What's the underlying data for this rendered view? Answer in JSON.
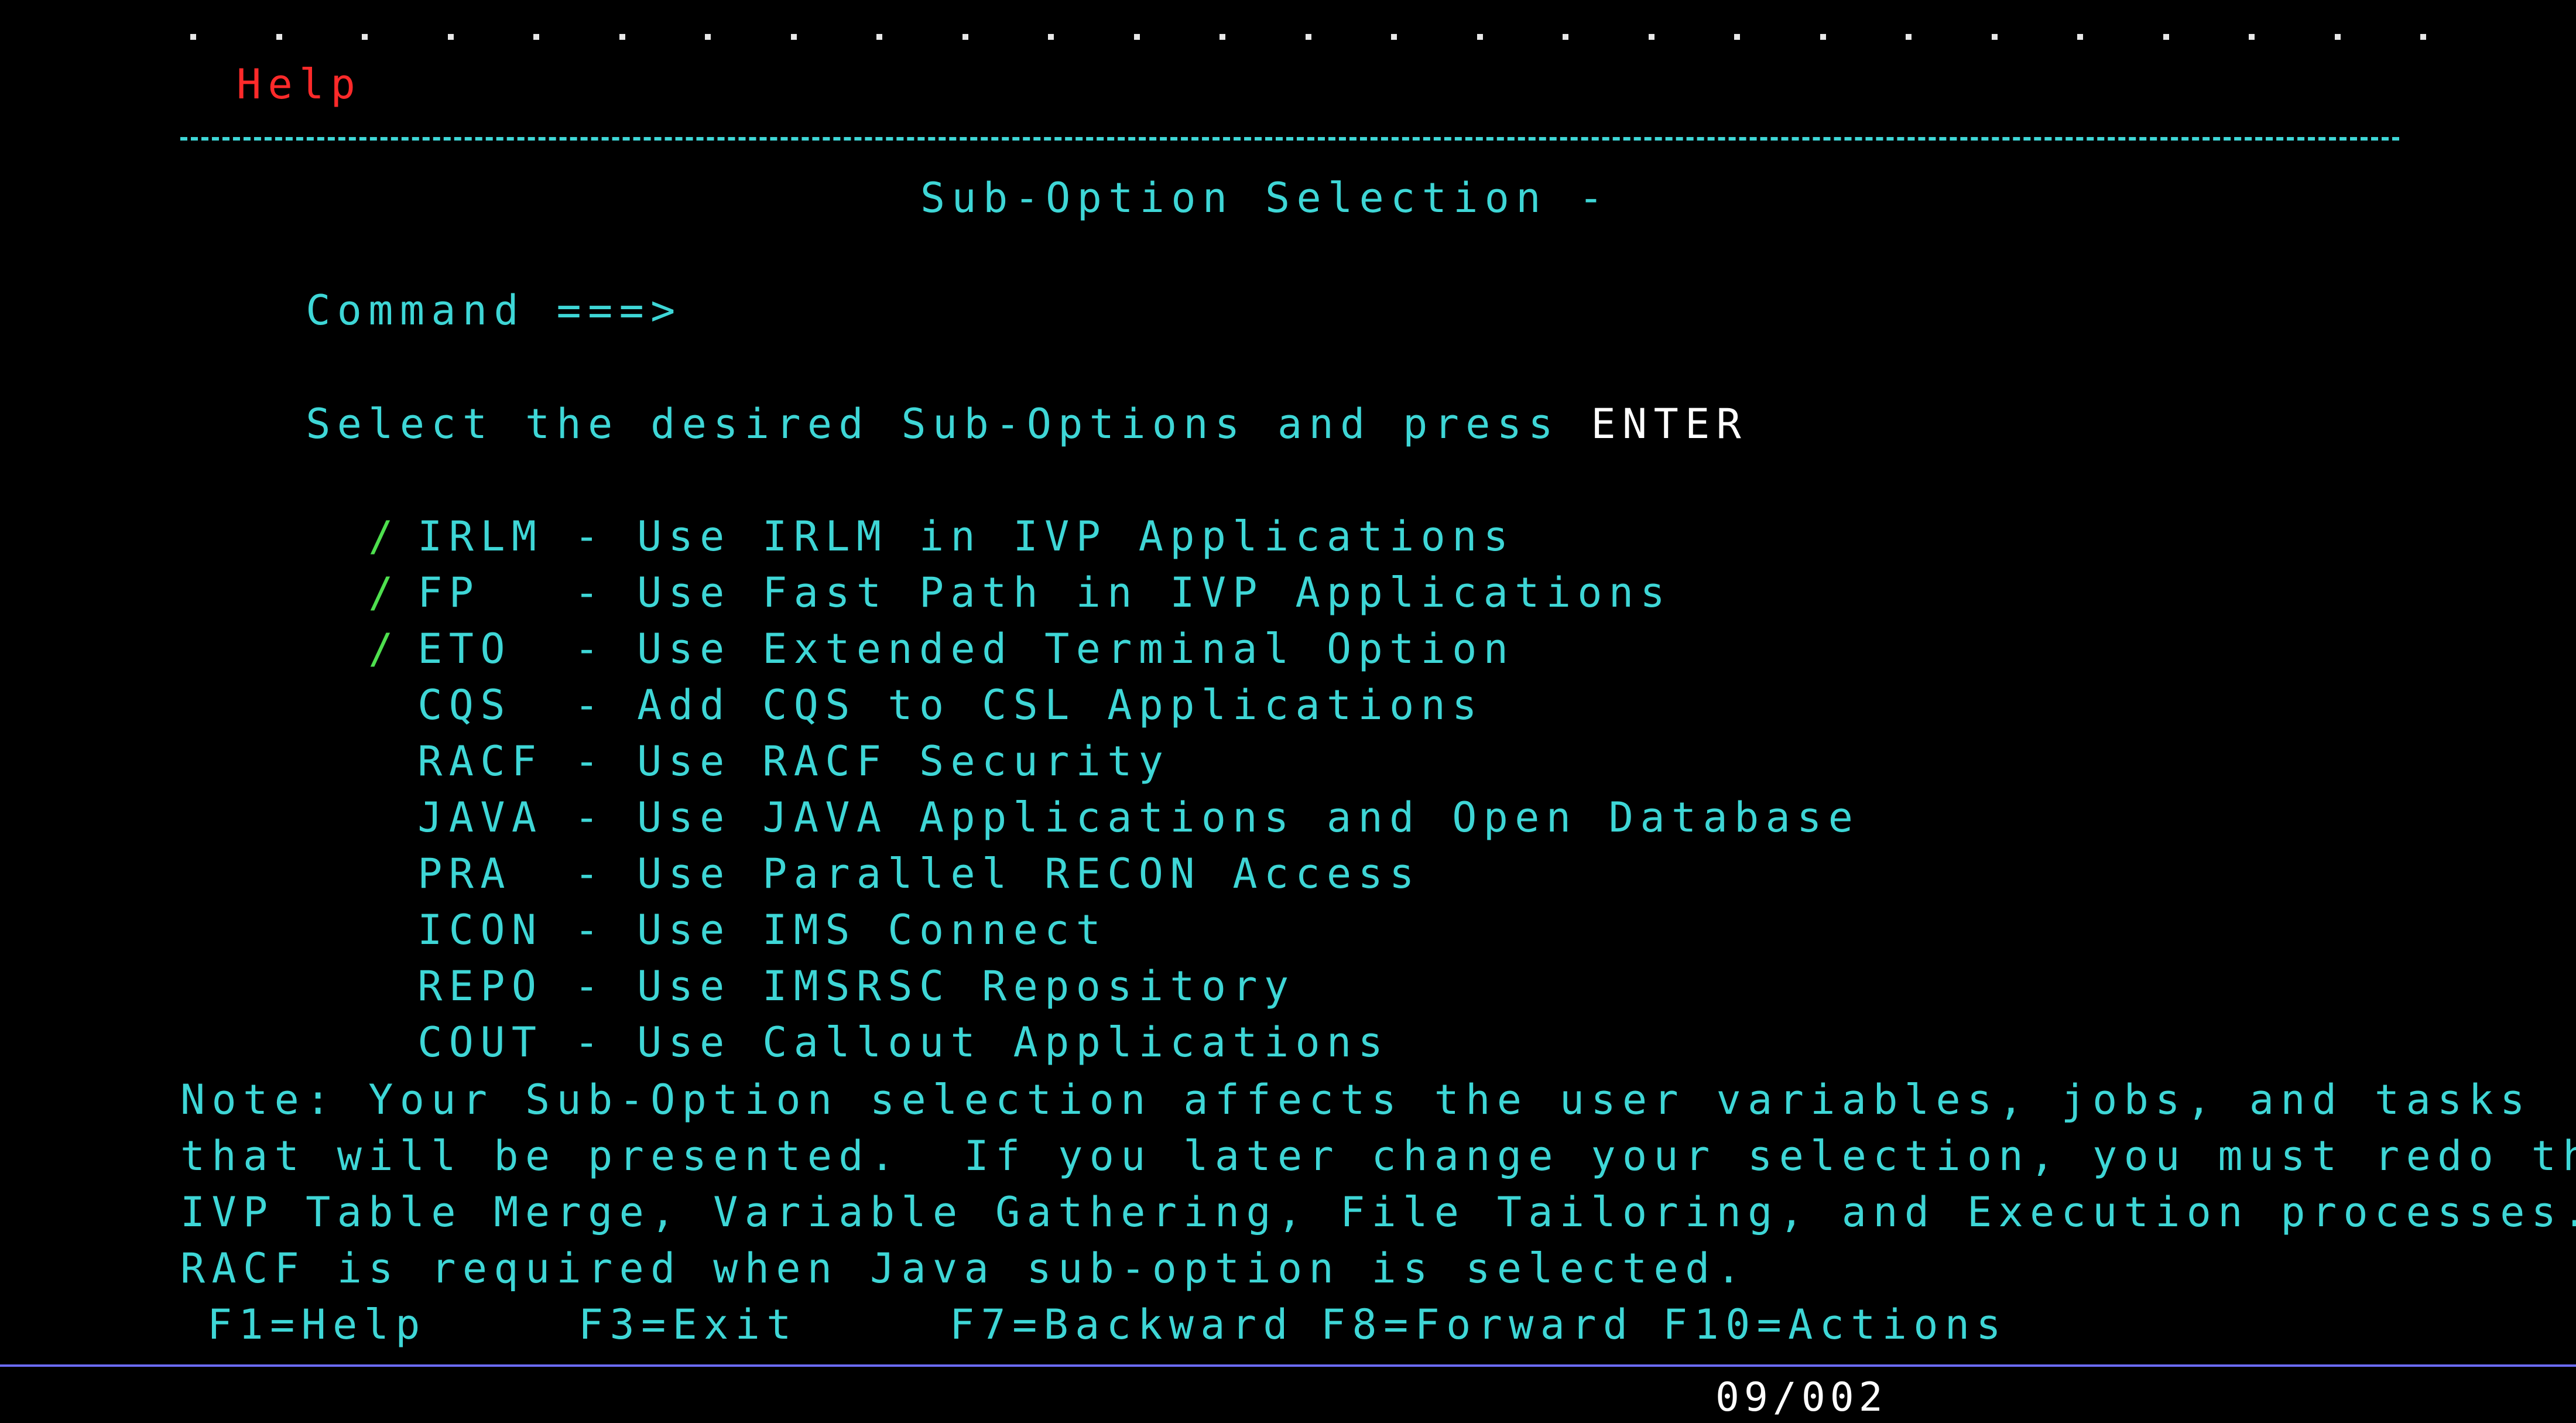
{
  "header": {
    "help_label": "Help"
  },
  "panel": {
    "title": "Sub-Option Selection -",
    "command_label": "Command ===>",
    "command_value": "",
    "instruction_prefix": "Select the desired Sub-Options and press ",
    "instruction_key": "ENTER"
  },
  "options": [
    {
      "selected": true,
      "slash": "/",
      "code": "IRLM",
      "description": "- Use IRLM in IVP Applications"
    },
    {
      "selected": true,
      "slash": "/",
      "code": "FP  ",
      "description": "- Use Fast Path in IVP Applications"
    },
    {
      "selected": true,
      "slash": "/",
      "code": "ETO ",
      "description": "- Use Extended Terminal Option"
    },
    {
      "selected": false,
      "slash": "",
      "code": "CQS ",
      "description": "- Add CQS to CSL Applications"
    },
    {
      "selected": false,
      "slash": "",
      "code": "RACF",
      "description": "- Use RACF Security"
    },
    {
      "selected": false,
      "slash": "",
      "code": "JAVA",
      "description": "- Use JAVA Applications and Open Database"
    },
    {
      "selected": false,
      "slash": "",
      "code": "PRA ",
      "description": "- Use Parallel RECON Access"
    },
    {
      "selected": false,
      "slash": "",
      "code": "ICON",
      "description": "- Use IMS Connect"
    },
    {
      "selected": false,
      "slash": "",
      "code": "REPO",
      "description": "- Use IMSRSC Repository"
    },
    {
      "selected": false,
      "slash": "",
      "code": "COUT",
      "description": "- Use Callout Applications"
    }
  ],
  "note": {
    "line1": "Note: Your Sub-Option selection affects the user variables, jobs, and tasks",
    "line2": "that will be presented.  If you later change your selection, you must redo the",
    "line3": "IVP Table Merge, Variable Gathering, File Tailoring, and Execution processes.",
    "line4": "RACF is required when Java sub-option is selected."
  },
  "function_keys": [
    {
      "label": "F1=Help"
    },
    {
      "label": "F3=Exit"
    },
    {
      "label": "F7=Backward"
    },
    {
      "label": "F8=Forward"
    },
    {
      "label": "F10=Actions"
    }
  ],
  "status": {
    "cursor_position": "09/002"
  },
  "colors": {
    "background": "#000000",
    "text_turquoise": "#3ed6d6",
    "text_white": "#ffffff",
    "text_red": "#ff2a2a",
    "text_green": "#4ee04e",
    "rule_blue": "#6c6cff"
  }
}
